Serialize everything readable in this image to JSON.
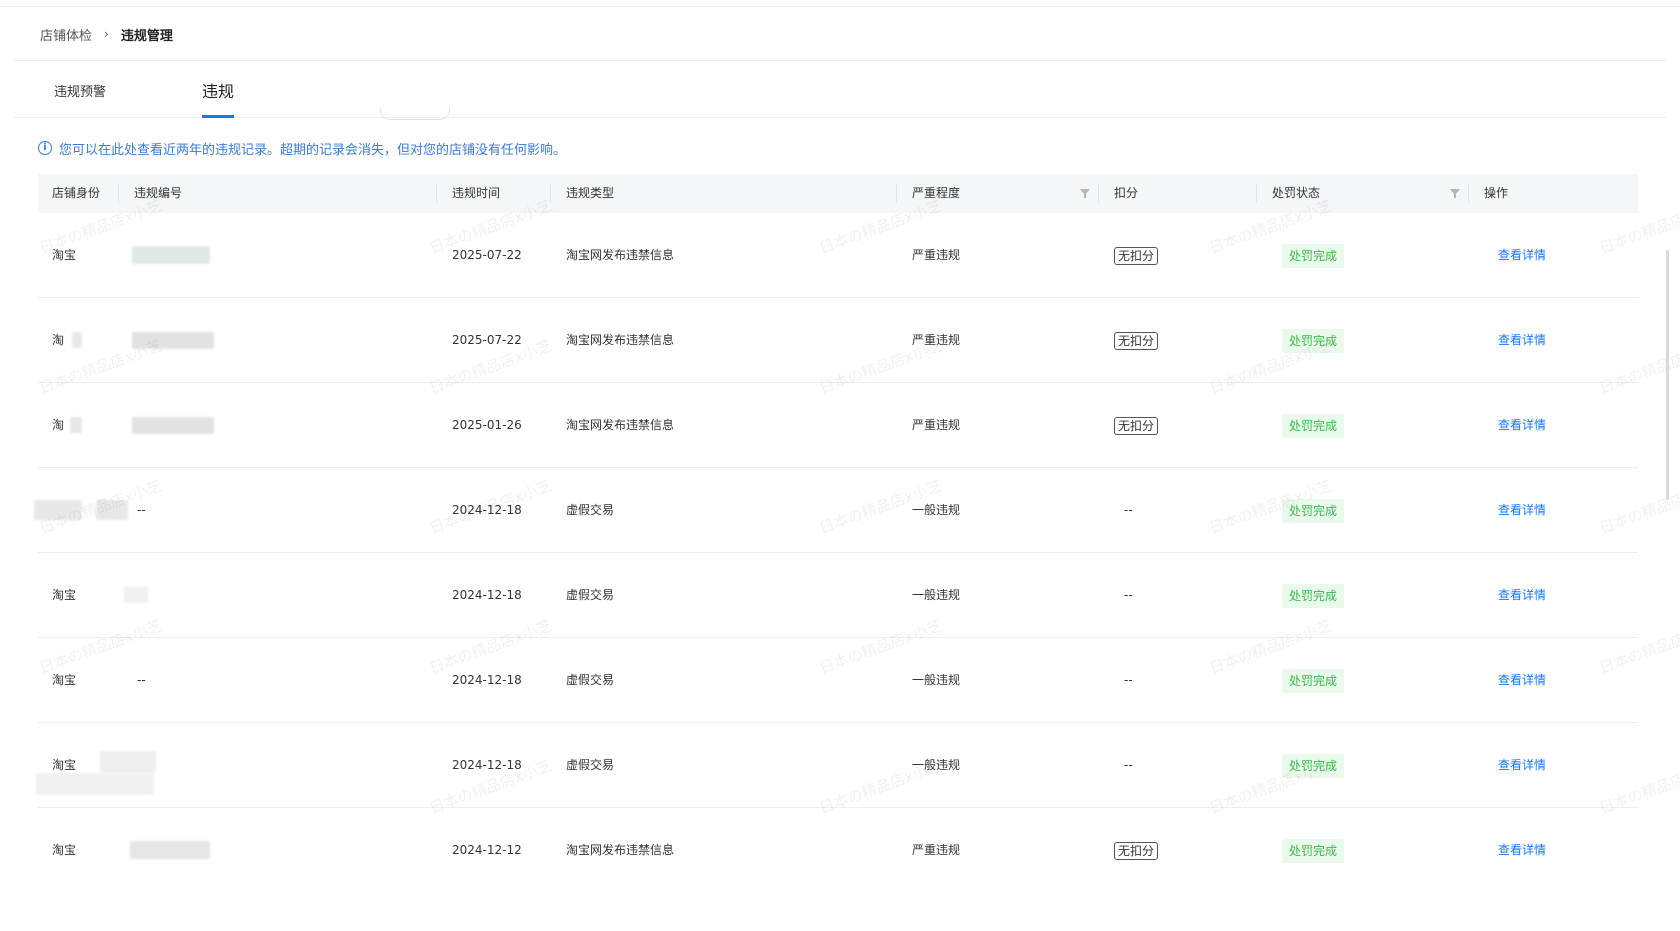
{
  "breadcrumb": {
    "items": [
      "店铺体检",
      "违规管理"
    ],
    "separator": "›"
  },
  "tabs": [
    {
      "label": "违规预警",
      "active": false
    },
    {
      "label": "违规",
      "active": true
    }
  ],
  "notice": {
    "icon": "info-icon",
    "text": "您可以在此处查看近两年的违规记录。超期的记录会消失，但对您的店铺没有任何影响。"
  },
  "table": {
    "headers": [
      "店铺身份",
      "违规编号",
      "违规时间",
      "违规类型",
      "严重程度",
      "扣分",
      "处罚状态",
      "操作"
    ],
    "rows": [
      {
        "shop": "淘宝",
        "code": "",
        "date": "2025-07-22",
        "type": "淘宝网发布违禁信息",
        "severity": "严重违规",
        "deduct": "无扣分",
        "status": "处罚完成",
        "action": "查看详情"
      },
      {
        "shop": "淘",
        "code": "",
        "date": "2025-07-22",
        "type": "淘宝网发布违禁信息",
        "severity": "严重违规",
        "deduct": "无扣分",
        "status": "处罚完成",
        "action": "查看详情"
      },
      {
        "shop": "淘",
        "code": "",
        "date": "2025-01-26",
        "type": "淘宝网发布违禁信息",
        "severity": "严重违规",
        "deduct": "无扣分",
        "status": "处罚完成",
        "action": "查看详情"
      },
      {
        "shop": "",
        "code": "--",
        "date": "2024-12-18",
        "type": "虚假交易",
        "severity": "一般违规",
        "deduct": "--",
        "status": "处罚完成",
        "action": "查看详情"
      },
      {
        "shop": "淘宝",
        "code": "",
        "date": "2024-12-18",
        "type": "虚假交易",
        "severity": "一般违规",
        "deduct": "--",
        "status": "处罚完成",
        "action": "查看详情"
      },
      {
        "shop": "淘宝",
        "code": "--",
        "date": "2024-12-18",
        "type": "虚假交易",
        "severity": "一般违规",
        "deduct": "--",
        "status": "处罚完成",
        "action": "查看详情"
      },
      {
        "shop": "淘宝",
        "code": "",
        "date": "2024-12-18",
        "type": "虚假交易",
        "severity": "一般违规",
        "deduct": "--",
        "status": "处罚完成",
        "action": "查看详情"
      },
      {
        "shop": "淘宝",
        "code": "",
        "date": "2024-12-12",
        "type": "淘宝网发布违禁信息",
        "severity": "严重违规",
        "deduct": "无扣分",
        "status": "处罚完成",
        "action": "查看详情"
      }
    ]
  },
  "watermark": "日本の精品店x小芝",
  "colors": {
    "accent": "#1677ff",
    "notice": "#3a7bd5",
    "status_bg": "#e9f9ec",
    "status_text": "#3cb94a",
    "header_bg": "#f5f6f8"
  }
}
